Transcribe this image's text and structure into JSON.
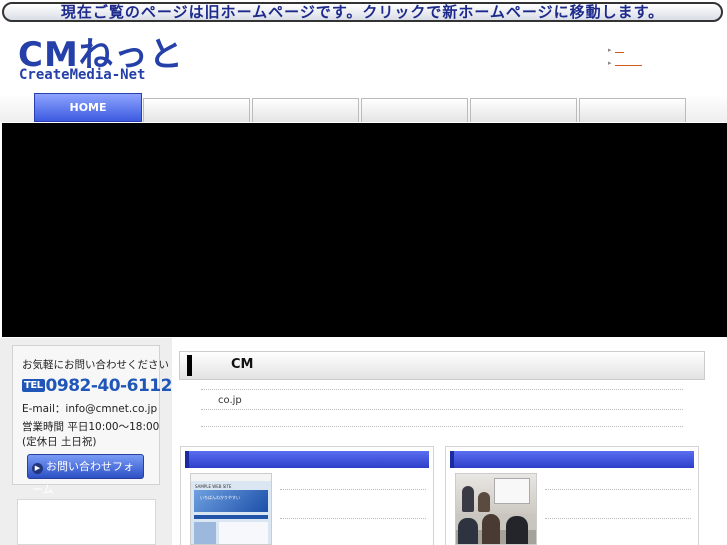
{
  "banner": {
    "text": "現在ご覧のページは旧ホームページです。クリックで新ホームページに移動します。"
  },
  "logo": {
    "mark": "CMねっと",
    "subtitle": "CreateMedia-Net"
  },
  "header_links": [
    {
      "text": "　"
    },
    {
      "text": "　　　"
    }
  ],
  "nav": {
    "home_label": "HOME",
    "tabs": [
      "",
      "",
      "",
      "",
      ""
    ]
  },
  "sidebar": {
    "contact_heading": "お気軽にお問い合わせください",
    "tel_badge": "TEL",
    "tel_number": "0982-40-6112",
    "email": "E-mail：info@cmnet.co.jp",
    "hours": "営業時間 平日10:00〜18:00",
    "holiday": "(定休日 土日祝)",
    "form_button": "お問い合わせフォーム"
  },
  "main": {
    "section_title": "CM",
    "intro_text": "co.jp"
  },
  "cards": [
    {
      "title": "",
      "thumb_logo": "SAMPLE WEB SITE",
      "thumb_hero_text": "いちばんわかりやすい"
    },
    {
      "title": ""
    }
  ],
  "colors": {
    "brand_blue": "#2540a8",
    "nav_active": "#3c5ae0",
    "card_bar": "#2e3ec9",
    "link_orange": "#d4581a"
  }
}
